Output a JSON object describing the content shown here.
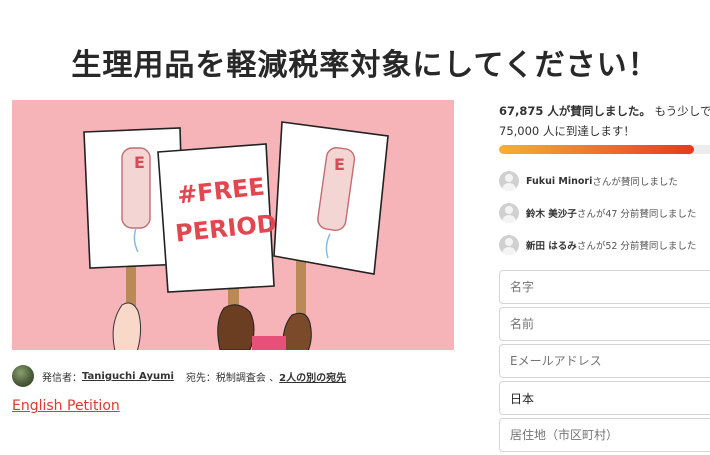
{
  "page": {
    "title": "生理用品を軽減税率対象にしてください！"
  },
  "hero": {
    "sign_text_line1": "#FREE",
    "sign_text_line2": "PERIODS"
  },
  "starter": {
    "prefix": "発信者：",
    "name": "Taniguchi Ayumi",
    "recipients_prefix": "宛先：税制調査会 、",
    "recipients_link": "2人の別の宛先"
  },
  "english_link": "English Petition",
  "progress": {
    "count": "67,875 人が賛同しました。",
    "more_text": "もう少しで",
    "goal": "75,000 人に到達します！",
    "fraction": 0.905
  },
  "recent_signers": [
    {
      "name": "Fukui Minori",
      "action": "さんが賛同しました"
    },
    {
      "name": "鈴木 美沙子",
      "action": "さんが47 分前賛同しました"
    },
    {
      "name": "新田 はるみ",
      "action": "さんが52 分前賛同しました"
    }
  ],
  "form": {
    "last_name_placeholder": "名字",
    "first_name_placeholder": "名前",
    "email_placeholder": "Eメールアドレス",
    "country_value": "日本",
    "address_placeholder": "居住地（市区町村）"
  },
  "colors": {
    "hero_bg": "#f6b3b8",
    "link_red": "#e0392d",
    "progress_start": "#f7b033",
    "progress_end": "#e8381f"
  }
}
